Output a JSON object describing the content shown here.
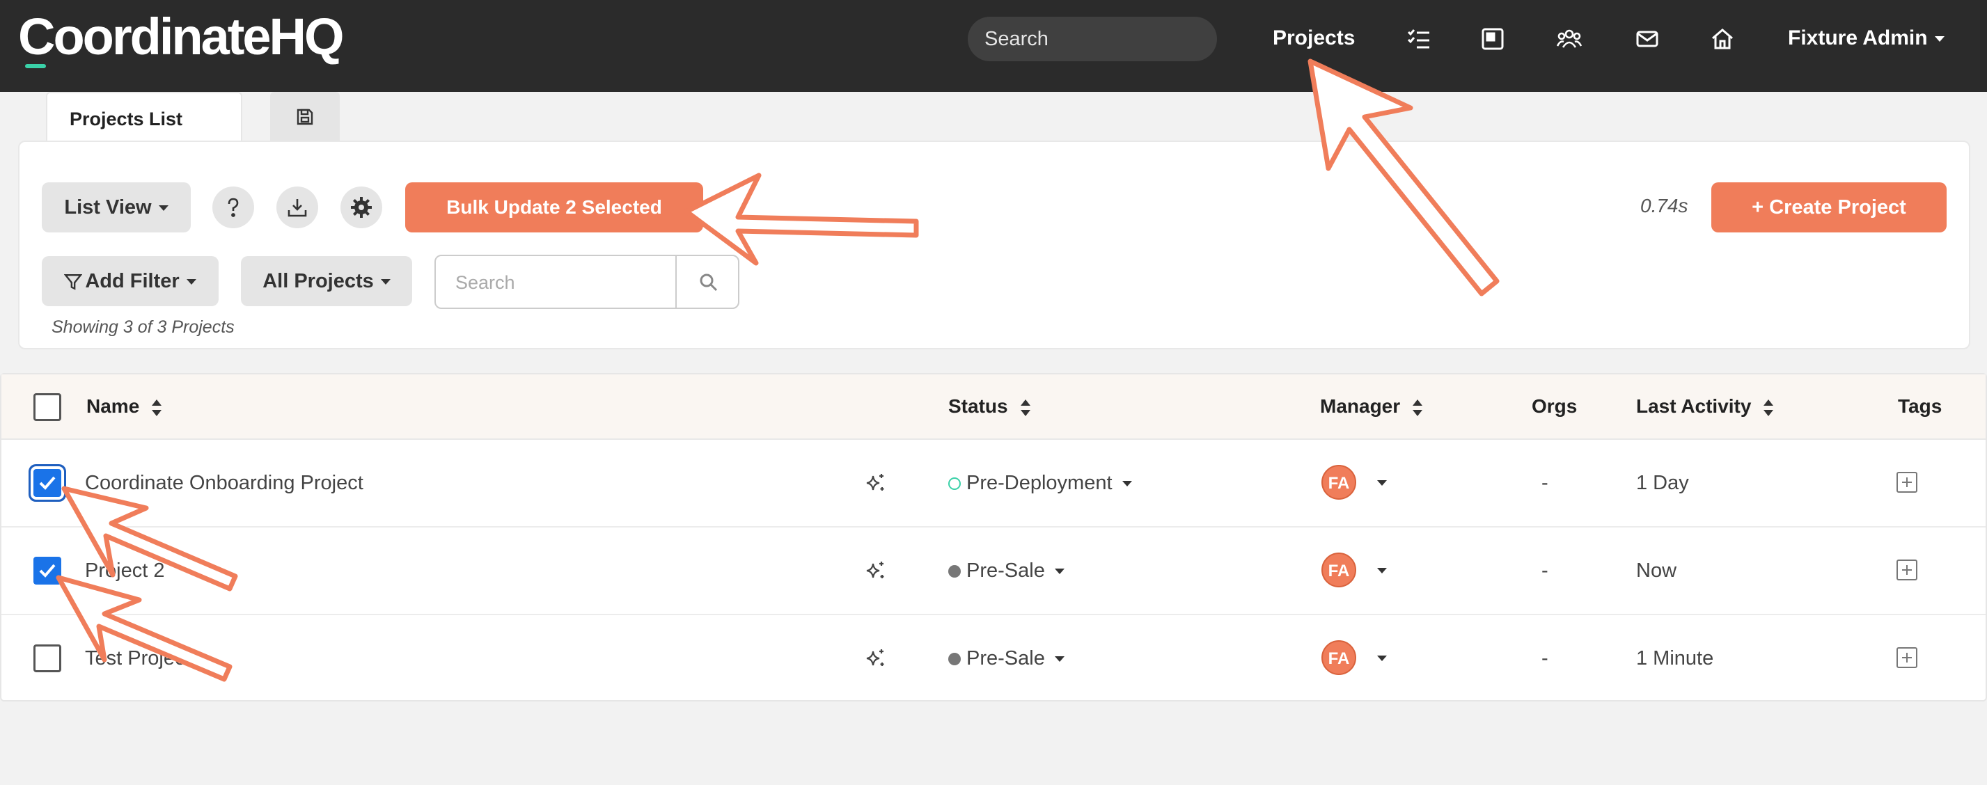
{
  "app": {
    "logo": "CoordinateHQ"
  },
  "nav": {
    "search_label": "Search",
    "projects_label": "Projects",
    "user_label": "Fixture Admin",
    "icons": [
      "tasks-icon",
      "board-icon",
      "team-icon",
      "mail-icon",
      "home-icon"
    ]
  },
  "tabs": {
    "active_label": "Projects List"
  },
  "toolbar": {
    "view_label": "List View",
    "bulk_label": "Bulk Update 2 Selected",
    "timing": "0.74s",
    "create_label": "+ Create Project",
    "add_filter_label": "Add Filter",
    "all_projects_label": "All Projects",
    "search_placeholder": "Search",
    "showing": "Showing 3 of 3 Projects"
  },
  "table": {
    "headers": {
      "name": "Name",
      "status": "Status",
      "manager": "Manager",
      "orgs": "Orgs",
      "last_activity": "Last Activity",
      "tags": "Tags"
    },
    "rows": [
      {
        "name": "Coordinate Onboarding Project",
        "status": "Pre-Deployment",
        "status_color": "#3ad1a8",
        "manager": "FA",
        "orgs": "-",
        "last_activity": "1 Day",
        "checked": true
      },
      {
        "name": "Project 2",
        "status": "Pre-Sale",
        "status_color": "#777777",
        "manager": "FA",
        "orgs": "-",
        "last_activity": "Now",
        "checked": true
      },
      {
        "name": "Test Project",
        "status": "Pre-Sale",
        "status_color": "#777777",
        "manager": "FA",
        "orgs": "-",
        "last_activity": "1 Minute",
        "checked": false
      }
    ]
  },
  "colors": {
    "accent": "#f07d5a",
    "nav_bg": "#2b2b2b",
    "checkbox_blue": "#1a73e8"
  }
}
